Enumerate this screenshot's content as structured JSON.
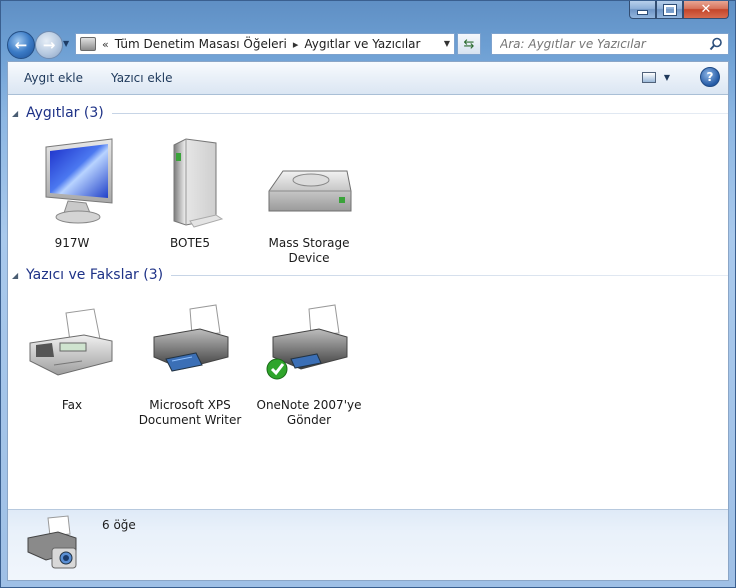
{
  "nav": {
    "address": {
      "overflow": "«",
      "crumbs": [
        "Tüm Denetim Masası Öğeleri",
        "Aygıtlar ve Yazıcılar"
      ],
      "separator": "▸"
    },
    "search_placeholder": "Ara: Aygıtlar ve Yazıcılar"
  },
  "toolbar": {
    "add_device": "Aygıt ekle",
    "add_printer": "Yazıcı ekle",
    "help": "?"
  },
  "groups": {
    "devices": {
      "title": "Aygıtlar (3)",
      "items": [
        {
          "label": "917W",
          "icon": "monitor-icon"
        },
        {
          "label": "BOTE5",
          "icon": "external-drive-icon"
        },
        {
          "label": "Mass Storage Device",
          "icon": "hard-disk-icon"
        }
      ]
    },
    "printers": {
      "title": "Yazıcı ve Fakslar (3)",
      "items": [
        {
          "label": "Fax",
          "icon": "fax-icon"
        },
        {
          "label": "Microsoft XPS Document Writer",
          "icon": "printer-icon"
        },
        {
          "label": "OneNote 2007'ye Gönder",
          "icon": "default-printer-icon",
          "default": true
        }
      ]
    }
  },
  "status": {
    "count": "6 öğe"
  },
  "colors": {
    "group_title": "#1e3287",
    "toolbar_text": "#1e395b",
    "default_check": "#2fa52b"
  }
}
